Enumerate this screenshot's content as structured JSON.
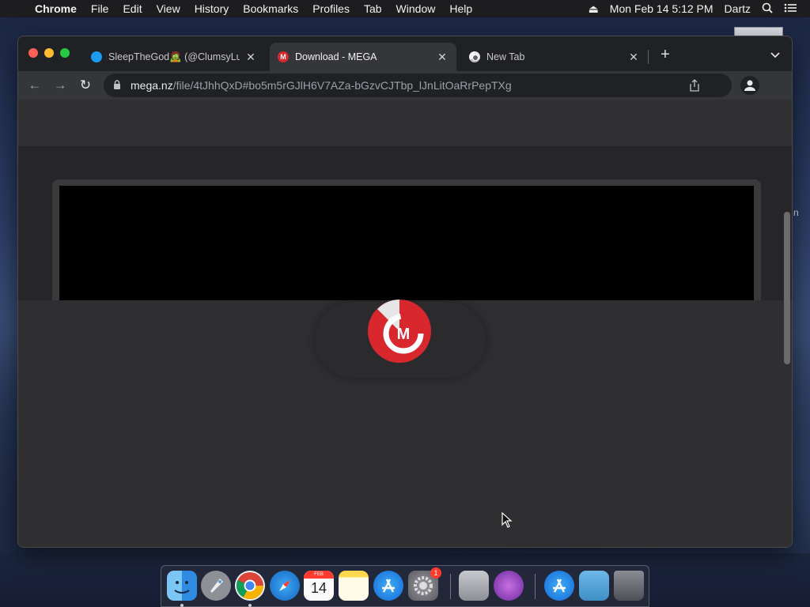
{
  "menubar": {
    "app_name": "Chrome",
    "items": [
      "File",
      "Edit",
      "View",
      "History",
      "Bookmarks",
      "Profiles",
      "Tab",
      "Window",
      "Help"
    ],
    "datetime": "Mon Feb 14  5:12 PM",
    "user": "Dartz"
  },
  "desktop": {
    "edge_text": "n"
  },
  "browser": {
    "tabs": [
      {
        "title": "SleepTheGod🧟 (@ClumsyLulz",
        "favicon": "twitter-icon",
        "active": false
      },
      {
        "title": "Download - MEGA",
        "favicon": "mega-icon",
        "active": true
      },
      {
        "title": "New Tab",
        "favicon": "chrome-icon",
        "active": false
      }
    ],
    "new_tab_label": "+",
    "address": {
      "host": "mega.nz",
      "path": "/file/4tJhhQxD#bo5m5rGJlH6V7AZa-bGzvCJTbp_lJnLitOaRrPepTXg"
    }
  },
  "page": {
    "logo": "mega-logo",
    "loading": true
  },
  "dock": {
    "apps": [
      "Finder",
      "Launchpad",
      "Google Chrome",
      "Safari",
      "Calendar",
      "Notes",
      "App Store",
      "System Preferences",
      "Disk Utility",
      "Instruments",
      "App Store",
      "Downloads",
      "Trash"
    ],
    "calendar": {
      "month": "FEB",
      "day": "14"
    },
    "sysprefs_badge": "1"
  },
  "colors": {
    "accent_mega": "#d9272e",
    "menubar_bg": "#1d1d1f",
    "tabstrip_bg": "#202124",
    "toolbar_bg": "#35363a"
  }
}
